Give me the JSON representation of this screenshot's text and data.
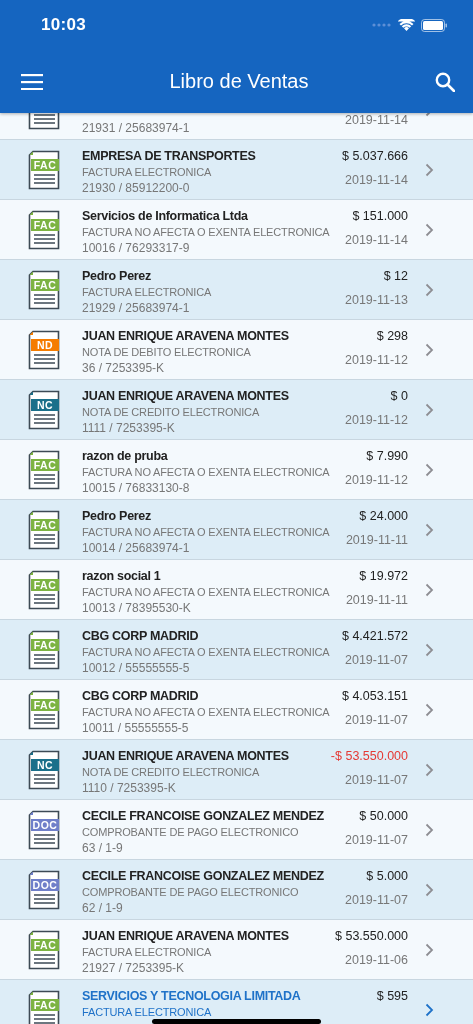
{
  "status_bar": {
    "time": "10:03"
  },
  "nav_bar": {
    "title": "Libro de Ventas"
  },
  "documents": [
    {
      "ref": "21931 / 25683974-1",
      "date": "2019-11-14",
      "selected": false
    },
    {
      "badge": "FAC",
      "color": "#7cb342",
      "name": "EMPRESA DE TRANSPORTES",
      "type": "FACTURA ELECTRONICA",
      "ref": "21930 / 85912200-0",
      "amount": "$ 5.037.666",
      "date": "2019-11-14",
      "selected": false,
      "negative": false
    },
    {
      "badge": "FAC",
      "color": "#7cb342",
      "name": "Servicios de Informatica Ltda",
      "type": "FACTURA NO AFECTA O EXENTA ELECTRONICA",
      "ref": "10016 / 76293317-9",
      "amount": "$ 151.000",
      "date": "2019-11-14",
      "selected": false,
      "negative": false
    },
    {
      "badge": "FAC",
      "color": "#7cb342",
      "name": "Pedro Perez",
      "type": "FACTURA ELECTRONICA",
      "ref": "21929 / 25683974-1",
      "amount": "$ 12",
      "date": "2019-11-13",
      "selected": false,
      "negative": false
    },
    {
      "badge": "ND",
      "color": "#f57c00",
      "name": "JUAN ENRIQUE ARAVENA MONTES",
      "type": "NOTA DE DEBITO ELECTRONICA",
      "ref": "36 / 7253395-K",
      "amount": "$ 298",
      "date": "2019-11-12",
      "selected": false,
      "negative": false
    },
    {
      "badge": "NC",
      "color": "#1a6f8a",
      "name": "JUAN ENRIQUE ARAVENA MONTES",
      "type": "NOTA DE CREDITO ELECTRONICA",
      "ref": "1111 / 7253395-K",
      "amount": "$ 0",
      "date": "2019-11-12",
      "selected": false,
      "negative": false
    },
    {
      "badge": "FAC",
      "color": "#7cb342",
      "name": "razon de pruba",
      "type": "FACTURA NO AFECTA O EXENTA ELECTRONICA",
      "ref": "10015 / 76833130-8",
      "amount": "$ 7.990",
      "date": "2019-11-12",
      "selected": false,
      "negative": false
    },
    {
      "badge": "FAC",
      "color": "#7cb342",
      "name": "Pedro Perez",
      "type": "FACTURA NO AFECTA O EXENTA ELECTRONICA",
      "ref": "10014 / 25683974-1",
      "amount": "$ 24.000",
      "date": "2019-11-11",
      "selected": false,
      "negative": false
    },
    {
      "badge": "FAC",
      "color": "#7cb342",
      "name": "razon social 1",
      "type": "FACTURA NO AFECTA O EXENTA ELECTRONICA",
      "ref": "10013 / 78395530-K",
      "amount": "$ 19.972",
      "date": "2019-11-11",
      "selected": false,
      "negative": false
    },
    {
      "badge": "FAC",
      "color": "#7cb342",
      "name": "CBG CORP MADRID",
      "type": "FACTURA NO AFECTA O EXENTA ELECTRONICA",
      "ref": "10012 / 55555555-5",
      "amount": "$ 4.421.572",
      "date": "2019-11-07",
      "selected": false,
      "negative": false
    },
    {
      "badge": "FAC",
      "color": "#7cb342",
      "name": "CBG CORP MADRID",
      "type": "FACTURA NO AFECTA O EXENTA ELECTRONICA",
      "ref": "10011 / 55555555-5",
      "amount": "$ 4.053.151",
      "date": "2019-11-07",
      "selected": false,
      "negative": false
    },
    {
      "badge": "NC",
      "color": "#1a6f8a",
      "name": "JUAN ENRIQUE ARAVENA MONTES",
      "type": "NOTA DE CREDITO ELECTRONICA",
      "ref": "1110 / 7253395-K",
      "amount": "-$ 53.550.000",
      "date": "2019-11-07",
      "selected": false,
      "negative": true
    },
    {
      "badge": "DOC",
      "color": "#6f7fc9",
      "name": "CECILE FRANCOISE GONZALEZ MENDEZ",
      "type": "COMPROBANTE DE PAGO ELECTRONICO",
      "ref": "63 / 1-9",
      "amount": "$ 50.000",
      "date": "2019-11-07",
      "selected": false,
      "negative": false
    },
    {
      "badge": "DOC",
      "color": "#6f7fc9",
      "name": "CECILE FRANCOISE GONZALEZ MENDEZ",
      "type": "COMPROBANTE DE PAGO ELECTRONICO",
      "ref": "62 / 1-9",
      "amount": "$ 5.000",
      "date": "2019-11-07",
      "selected": false,
      "negative": false
    },
    {
      "badge": "FAC",
      "color": "#7cb342",
      "name": "JUAN ENRIQUE ARAVENA MONTES",
      "type": "FACTURA ELECTRONICA",
      "ref": "21927 / 7253395-K",
      "amount": "$ 53.550.000",
      "date": "2019-11-06",
      "selected": false,
      "negative": false
    },
    {
      "badge": "FAC",
      "color": "#7cb342",
      "name": "SERVICIOS Y TECNOLOGIA LIMITADA",
      "type": "FACTURA ELECTRONICA",
      "amount": "$ 595",
      "selected": true,
      "negative": false
    }
  ]
}
